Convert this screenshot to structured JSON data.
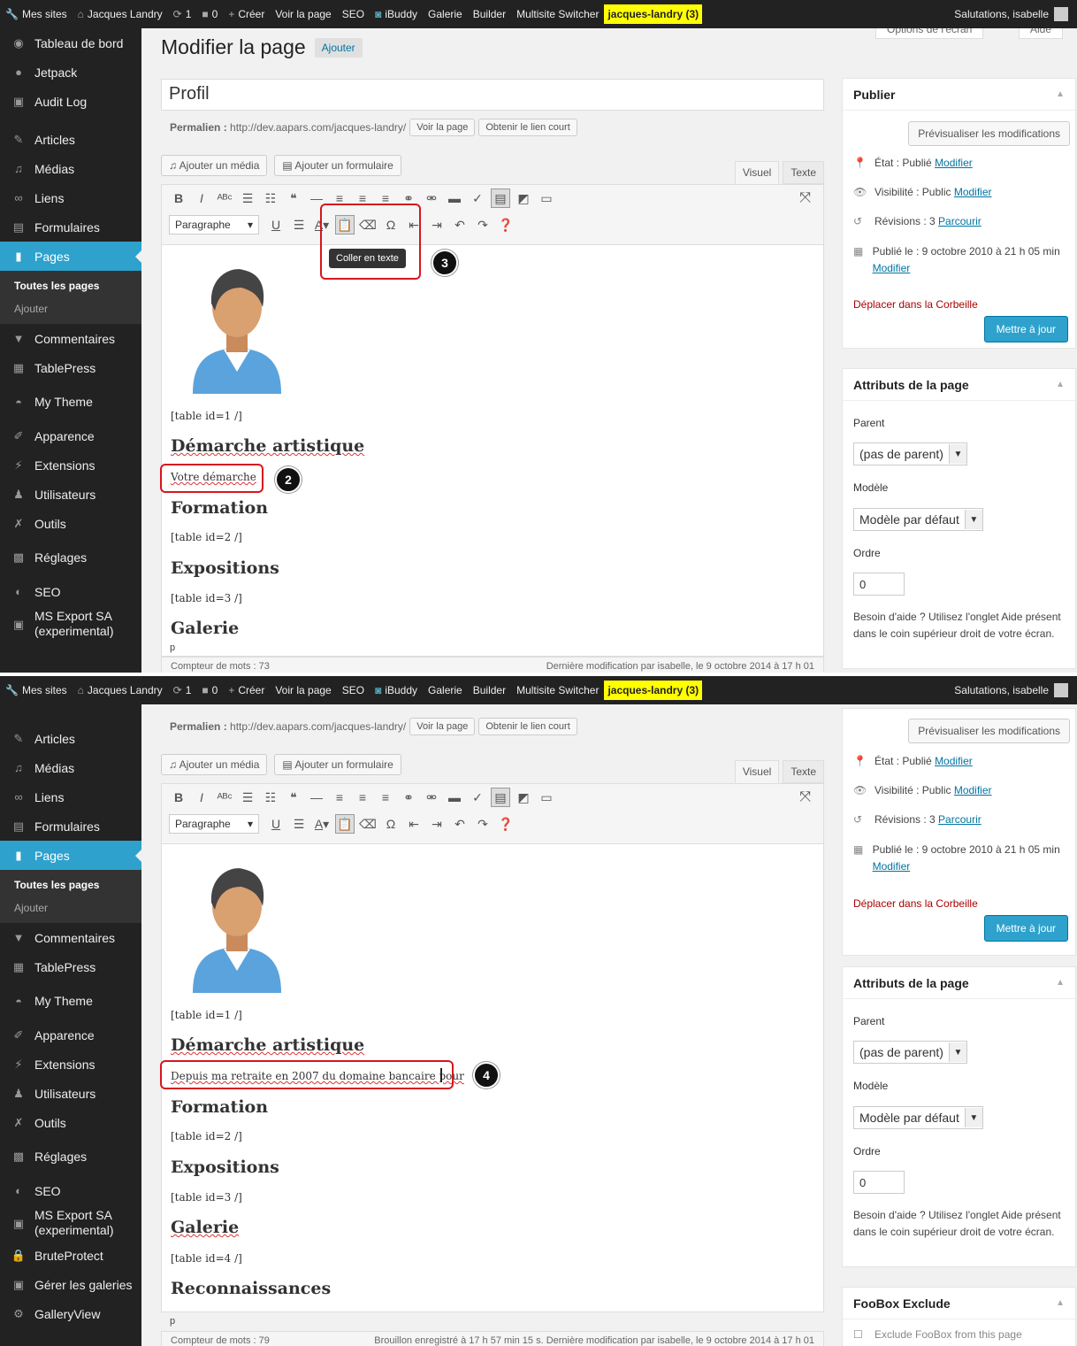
{
  "adminbar": {
    "items": [
      "Mes sites",
      "Jacques Landry",
      "1",
      "0",
      "Créer",
      "Voir la page",
      "SEO",
      "iBuddy",
      "Galerie",
      "Builder",
      "Multisite Switcher"
    ],
    "highlight": "jacques-landry (3)",
    "greeting": "Salutations, isabelle",
    "icons": [
      "wrench-icon",
      "home-icon",
      "refresh-icon",
      "comment-icon",
      "plus-icon"
    ]
  },
  "menu1": [
    "Tableau de bord",
    "Jetpack",
    "Audit Log",
    "Articles",
    "Médias",
    "Liens",
    "Formulaires",
    "Pages"
  ],
  "menu_sub": {
    "all": "Toutes les pages",
    "add": "Ajouter"
  },
  "menu1b": [
    "Commentaires",
    "TablePress",
    "My Theme",
    "Apparence",
    "Extensions",
    "Utilisateurs",
    "Outils",
    "Réglages",
    "SEO"
  ],
  "menu_export": {
    "line1": "MS Export SA",
    "line2": "(experimental)"
  },
  "menu2a": [
    "Articles",
    "Médias",
    "Liens",
    "Formulaires",
    "Pages"
  ],
  "menu2b": [
    "Commentaires",
    "TablePress",
    "My Theme",
    "Apparence",
    "Extensions",
    "Utilisateurs",
    "Outils",
    "Réglages",
    "SEO"
  ],
  "menu2c": [
    "BruteProtect",
    "Gérer les galeries",
    "GalleryView"
  ],
  "screen_options": {
    "options": "Options de l'écran",
    "help": "Aide"
  },
  "page": {
    "heading": "Modifier la page",
    "add": "Ajouter",
    "title": "Profil",
    "permalink_label": "Permalien :",
    "permalink_url": "http://dev.aapars.com/jacques-landry/",
    "view_page": "Voir la page",
    "short_link": "Obtenir le lien court",
    "add_media": "Ajouter un média",
    "add_form": "Ajouter un formulaire",
    "tab_visual": "Visuel",
    "tab_text": "Texte",
    "format": "Paragraphe",
    "tooltip": "Coller en texte"
  },
  "content1": {
    "table1": "[table id=1 /]",
    "h_demarche": "Démarche artistique",
    "votre": "Votre démarche",
    "h_formation": "Formation",
    "table2": "[table id=2 /]",
    "h_expos": "Expositions",
    "table3": "[table id=3 /]",
    "h_galerie": "Galerie",
    "path": "p",
    "word_count": "Compteur de mots : 73",
    "last_mod": "Dernière modification par isabelle, le 9 octobre 2014 à 17 h 01"
  },
  "content2": {
    "table1": "[table id=1 /]",
    "h_demarche": "Démarche artistique",
    "depuis": "Depuis ma retraite en 2007 du domaine bancaire pour",
    "h_formation": "Formation",
    "table2": "[table id=2 /]",
    "h_expos": "Expositions",
    "table3": "[table id=3 /]",
    "h_galerie": "Galerie",
    "table4": "[table id=4 /]",
    "h_recon": "Reconnaissances",
    "path": "p",
    "word_count": "Compteur de mots : 79",
    "last_mod": "Brouillon enregistré à 17 h 57 min 15 s. Dernière modification par isabelle, le 9 octobre 2014 à 17 h 01"
  },
  "publish": {
    "title": "Publier",
    "preview": "Prévisualiser les modifications",
    "state_label": "État : Publié",
    "visibility_label": "Visibilité : Public",
    "revisions_label": "Révisions : 3",
    "browse": "Parcourir",
    "published_label": "Publié le : 9 octobre 2010 à 21 h 05",
    "published_tail": "min",
    "modify": "Modifier",
    "trash": "Déplacer dans la Corbeille",
    "update": "Mettre à jour"
  },
  "attributes": {
    "title": "Attributs de la page",
    "parent_label": "Parent",
    "parent_value": "(pas de parent)",
    "model_label": "Modèle",
    "model_value": "Modèle par défaut",
    "order_label": "Ordre",
    "order_value": "0",
    "help": "Besoin d'aide ? Utilisez l'onglet Aide présent dans le coin supérieur droit de votre écran."
  },
  "foobox": {
    "title": "FooBox Exclude",
    "option": "Exclude FooBox from this page"
  },
  "badges": [
    "2",
    "3",
    "4"
  ],
  "colors": {
    "accent": "#2ea2cc",
    "annotation": "#d6161e",
    "adminbar": "#222222",
    "highlight": "#ffff00"
  }
}
